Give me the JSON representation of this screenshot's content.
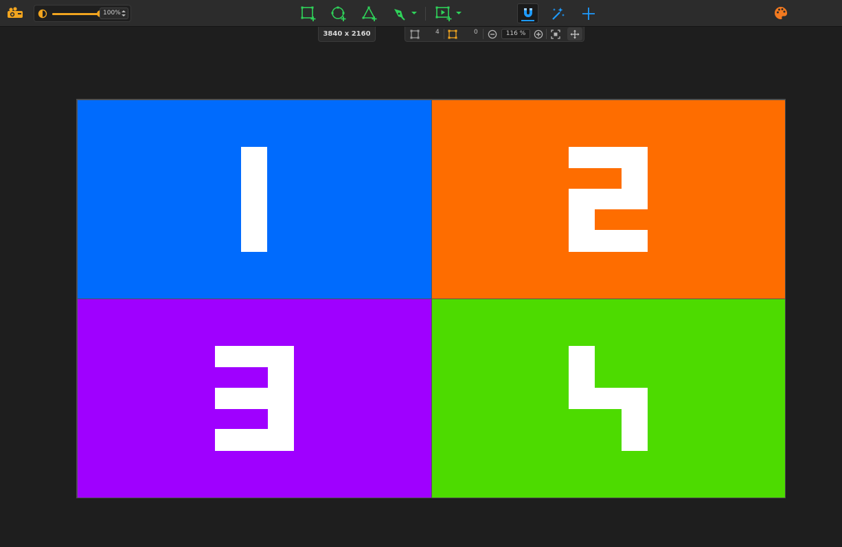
{
  "toolbar": {
    "logo_icon": "projector-icon",
    "opacity": {
      "value_label": "100%",
      "percent": 100,
      "icon": "half-circle-icon"
    },
    "tools": [
      {
        "name": "add-rectangle-surface",
        "icon": "rectangle-plus-icon",
        "color": "#2fd35a"
      },
      {
        "name": "add-circle-surface",
        "icon": "circle-plus-icon",
        "color": "#2fd35a"
      },
      {
        "name": "add-triangle-surface",
        "icon": "triangle-plus-icon",
        "color": "#2fd35a"
      },
      {
        "name": "pen-tool",
        "icon": "pen-nib-icon",
        "color": "#2fd35a",
        "has_dropdown": true
      },
      {
        "name": "add-media-surface",
        "icon": "media-rectangle-plus-icon",
        "color": "#2fd35a",
        "has_dropdown": true
      },
      {
        "name": "magnet-snap",
        "icon": "magnet-icon",
        "color": "#1e9bff",
        "active": true
      },
      {
        "name": "magic-wand",
        "icon": "magic-wand-icon",
        "color": "#1e9bff"
      },
      {
        "name": "crosshair",
        "icon": "crosshair-icon",
        "color": "#1e9bff"
      },
      {
        "name": "color-palette",
        "icon": "palette-icon",
        "color": "#f2791f"
      }
    ]
  },
  "resolution": {
    "label": "3840 x 2160"
  },
  "subbar": {
    "surfaces_count": "4",
    "selected_count": "0",
    "zoom_label": "116 %",
    "icons": [
      "surface-outline-icon",
      "surface-selected-icon",
      "zoom-out-icon",
      "zoom-in-icon",
      "fit-screen-icon",
      "move-icon"
    ]
  },
  "canvas": {
    "quadrants": [
      {
        "label": "1",
        "color": "#006bfd"
      },
      {
        "label": "2",
        "color": "#fe6d00"
      },
      {
        "label": "3",
        "color": "#9f00ff"
      },
      {
        "label": "4",
        "color": "#4ddb00"
      }
    ]
  },
  "colors": {
    "accent_orange": "#f2a51f",
    "tool_green": "#2fd35a",
    "tool_blue": "#1e9bff",
    "background": "#1e1e1e"
  }
}
